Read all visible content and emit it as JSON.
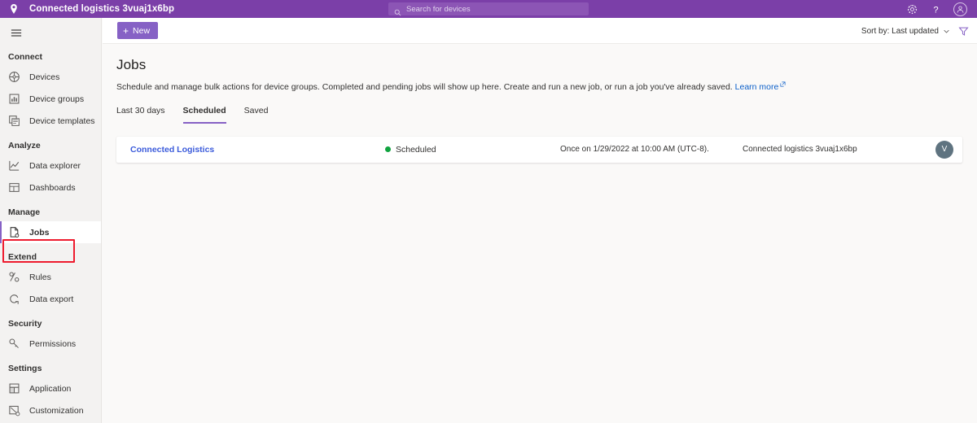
{
  "topbar": {
    "pin_icon": "location-pin-icon",
    "app_title": "Connected logistics 3vuaj1x6bp",
    "search": {
      "placeholder": "Search for devices",
      "value": "",
      "icon": "search-icon"
    },
    "settings_icon": "gear-icon",
    "help_icon": "question-mark-icon",
    "account_icon": "account-avatar-icon"
  },
  "sidebar": {
    "menu_icon": "hamburger-menu-icon",
    "groups": [
      {
        "label": "Connect",
        "items": [
          {
            "label": "Devices",
            "icon": "devices-icon",
            "selected": false
          },
          {
            "label": "Device groups",
            "icon": "device-groups-icon",
            "selected": false
          },
          {
            "label": "Device templates",
            "icon": "device-templates-icon",
            "selected": false
          }
        ]
      },
      {
        "label": "Analyze",
        "items": [
          {
            "label": "Data explorer",
            "icon": "data-explorer-icon",
            "selected": false
          },
          {
            "label": "Dashboards",
            "icon": "dashboards-icon",
            "selected": false
          }
        ]
      },
      {
        "label": "Manage",
        "items": [
          {
            "label": "Jobs",
            "icon": "jobs-icon",
            "selected": true
          }
        ]
      },
      {
        "label": "Extend",
        "items": [
          {
            "label": "Rules",
            "icon": "rules-icon",
            "selected": false
          },
          {
            "label": "Data export",
            "icon": "data-export-icon",
            "selected": false
          }
        ]
      },
      {
        "label": "Security",
        "items": [
          {
            "label": "Permissions",
            "icon": "permissions-key-icon",
            "selected": false
          }
        ]
      },
      {
        "label": "Settings",
        "items": [
          {
            "label": "Application",
            "icon": "application-icon",
            "selected": false
          },
          {
            "label": "Customization",
            "icon": "customization-icon",
            "selected": false
          }
        ]
      }
    ]
  },
  "commandbar": {
    "new_label": "New",
    "new_plus": "+",
    "sort_label": "Sort by: Last updated",
    "chevron_icon": "chevron-down-icon",
    "filter_icon": "filter-funnel-icon"
  },
  "main": {
    "title": "Jobs",
    "description": "Schedule and manage bulk actions for device groups. Completed and pending jobs will show up here. Create and run a new job, or run a job you've already saved.",
    "learn_more": "Learn more",
    "external_icon": "external-link-icon",
    "tabs": [
      {
        "label": "Last 30 days",
        "active": false
      },
      {
        "label": "Scheduled",
        "active": true
      },
      {
        "label": "Saved",
        "active": false
      }
    ],
    "rows": [
      {
        "name": "Connected Logistics",
        "status": "Scheduled",
        "status_color": "#10a33f",
        "schedule": "Once on 1/29/2022 at 10:00 AM (UTC-8).",
        "group": "Connected logistics 3vuaj1x6bp",
        "avatar_initial": "V"
      }
    ]
  },
  "colors": {
    "brand_purple": "#7b3fa8",
    "accent_purple": "#8661c5",
    "highlight_red": "#ee1b2e",
    "link_blue": "#3b5bdb"
  }
}
